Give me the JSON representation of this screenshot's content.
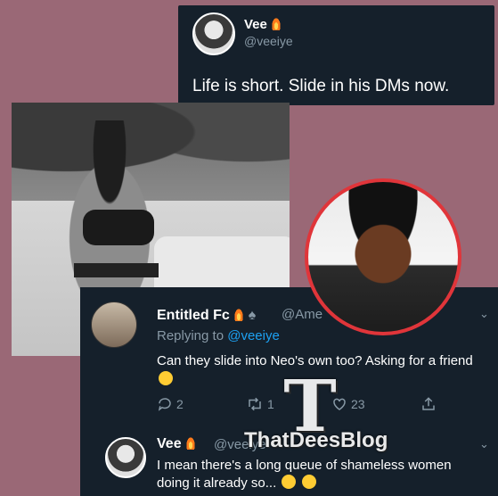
{
  "tweets": [
    {
      "author": "Vee",
      "handle": "@veeiye",
      "text": "Life is short. Slide in his DMs now."
    },
    {
      "author": "Entitled Fc",
      "handle": "@Ame",
      "replying_label": "Replying to",
      "replying_handle": "@veeiye",
      "text": "Can they slide into Neo's own too? Asking for a friend",
      "reply_count": "2",
      "retweet_count": "1",
      "like_count": "23"
    },
    {
      "author": "Vee",
      "handle": "@veeiye",
      "text": "I mean there's a long queue of shameless women doing it already so..."
    }
  ],
  "watermark": {
    "logo_letter": "T",
    "text": "ThatDeesBlog"
  },
  "icons": {
    "flame": "flame-icon",
    "reply": "reply-icon",
    "retweet": "retweet-icon",
    "like": "heart-icon",
    "share": "share-icon",
    "chevron": "chevron-down-icon"
  },
  "colors": {
    "background": "#9a6876",
    "card": "#15202b",
    "mention": "#1da1f2",
    "muted": "#8899a6",
    "portrait_ring": "#e0353a"
  }
}
